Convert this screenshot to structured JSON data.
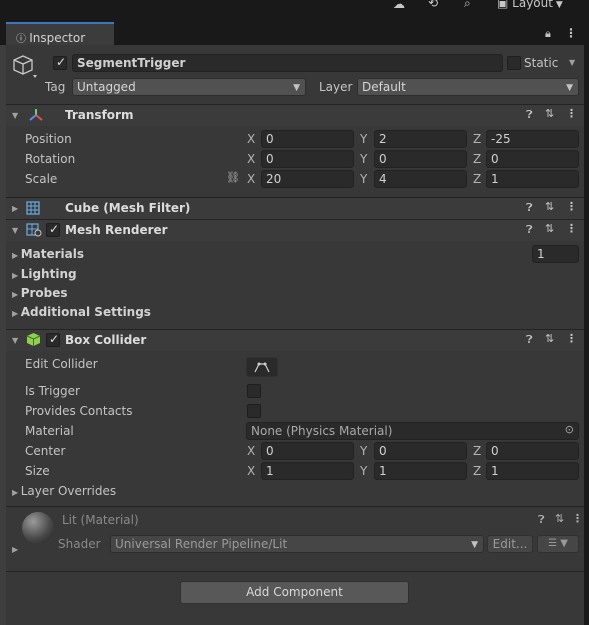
{
  "toolbar": {
    "layout_label": "Layout"
  },
  "tab": {
    "label": "Inspector"
  },
  "object": {
    "name": "SegmentTrigger",
    "static_label": "Static",
    "tag_label": "Tag",
    "tag_value": "Untagged",
    "layer_label": "Layer",
    "layer_value": "Default"
  },
  "transform": {
    "title": "Transform",
    "position_label": "Position",
    "rotation_label": "Rotation",
    "scale_label": "Scale",
    "position": {
      "x": "0",
      "y": "2",
      "z": "-25"
    },
    "rotation": {
      "x": "0",
      "y": "0",
      "z": "0"
    },
    "scale": {
      "x": "20",
      "y": "4",
      "z": "1"
    }
  },
  "axes": {
    "x": "X",
    "y": "Y",
    "z": "Z"
  },
  "mesh_filter": {
    "title": "Cube (Mesh Filter)"
  },
  "mesh_renderer": {
    "title": "Mesh Renderer",
    "materials_label": "Materials",
    "materials_count": "1",
    "lighting_label": "Lighting",
    "probes_label": "Probes",
    "additional_label": "Additional Settings"
  },
  "box_collider": {
    "title": "Box Collider",
    "edit_label": "Edit Collider",
    "is_trigger_label": "Is Trigger",
    "provides_contacts_label": "Provides Contacts",
    "material_label": "Material",
    "material_value": "None (Physics Material)",
    "center_label": "Center",
    "size_label": "Size",
    "center": {
      "x": "0",
      "y": "0",
      "z": "0"
    },
    "size": {
      "x": "1",
      "y": "1",
      "z": "1"
    },
    "layer_overrides_label": "Layer Overrides"
  },
  "material": {
    "name": "Lit (Material)",
    "shader_label": "Shader",
    "shader_value": "Universal Render Pipeline/Lit",
    "edit_label": "Edit..."
  },
  "add_component_label": "Add Component",
  "colors": {
    "accent": "#3a79bb",
    "panel": "#383838",
    "header": "#3b3b3b",
    "field": "#2a2a2a"
  }
}
